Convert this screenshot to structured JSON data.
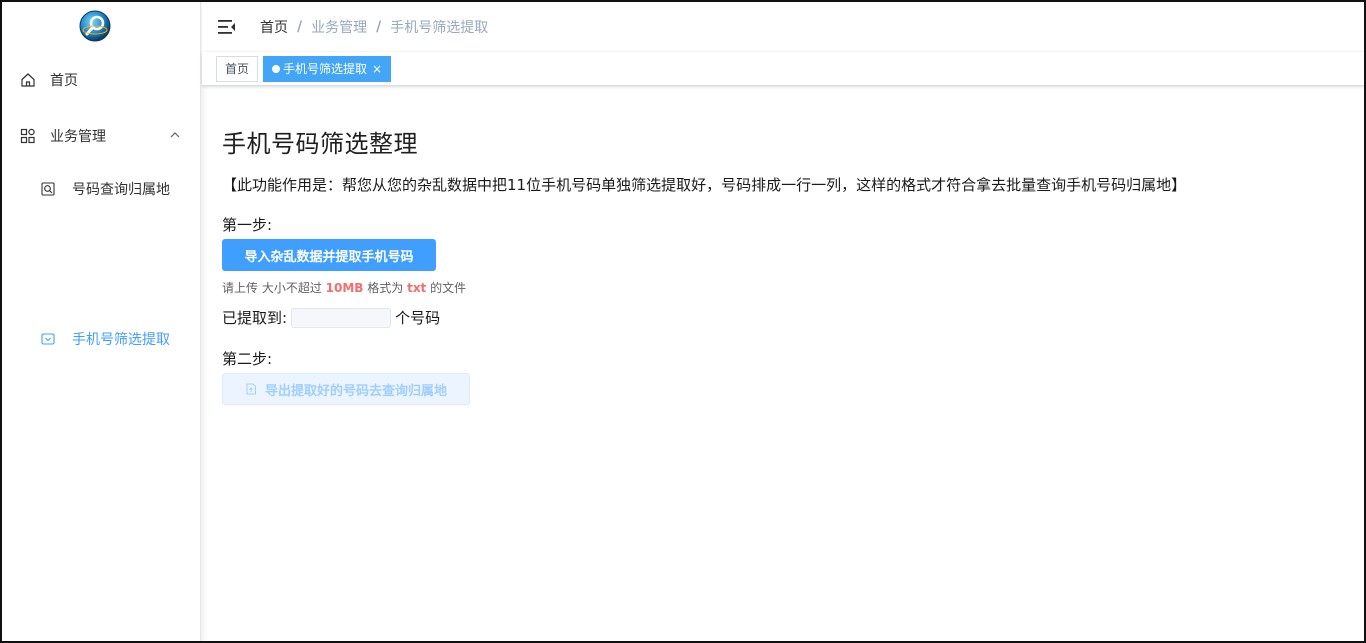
{
  "sidebar": {
    "logo_icon": "globe-logo-icon",
    "home_label": "首页",
    "biz_label": "业务管理",
    "sub_query_label": "号码查询归属地",
    "sub_filter_label": "手机号筛选提取",
    "active_color": "#409eff"
  },
  "navbar": {
    "breadcrumb": [
      "首页",
      "业务管理",
      "手机号筛选提取"
    ],
    "separator": "/"
  },
  "tags": {
    "home_label": "首页",
    "active_label": "手机号筛选提取",
    "close_glyph": "×",
    "active_color": "#42a5f5"
  },
  "main": {
    "title": "手机号码筛选整理",
    "description": "【此功能作用是：帮您从您的杂乱数据中把11位手机号码单独筛选提取好，号码排成一行一列，这样的格式才符合拿去批量查询手机号码归属地】",
    "step1_label": "第一步:",
    "import_button": "导入杂乱数据并提取手机号码",
    "tip": {
      "prefix": "请上传 大小不超过 ",
      "size": "10MB",
      "middle": " 格式为 ",
      "format": "txt",
      "suffix": " 的文件"
    },
    "extracted_prefix": "已提取到:",
    "extracted_count": "",
    "extracted_suffix": "个号码",
    "step2_label": "第二步:",
    "export_button": "导出提取好的号码去查询归属地"
  }
}
